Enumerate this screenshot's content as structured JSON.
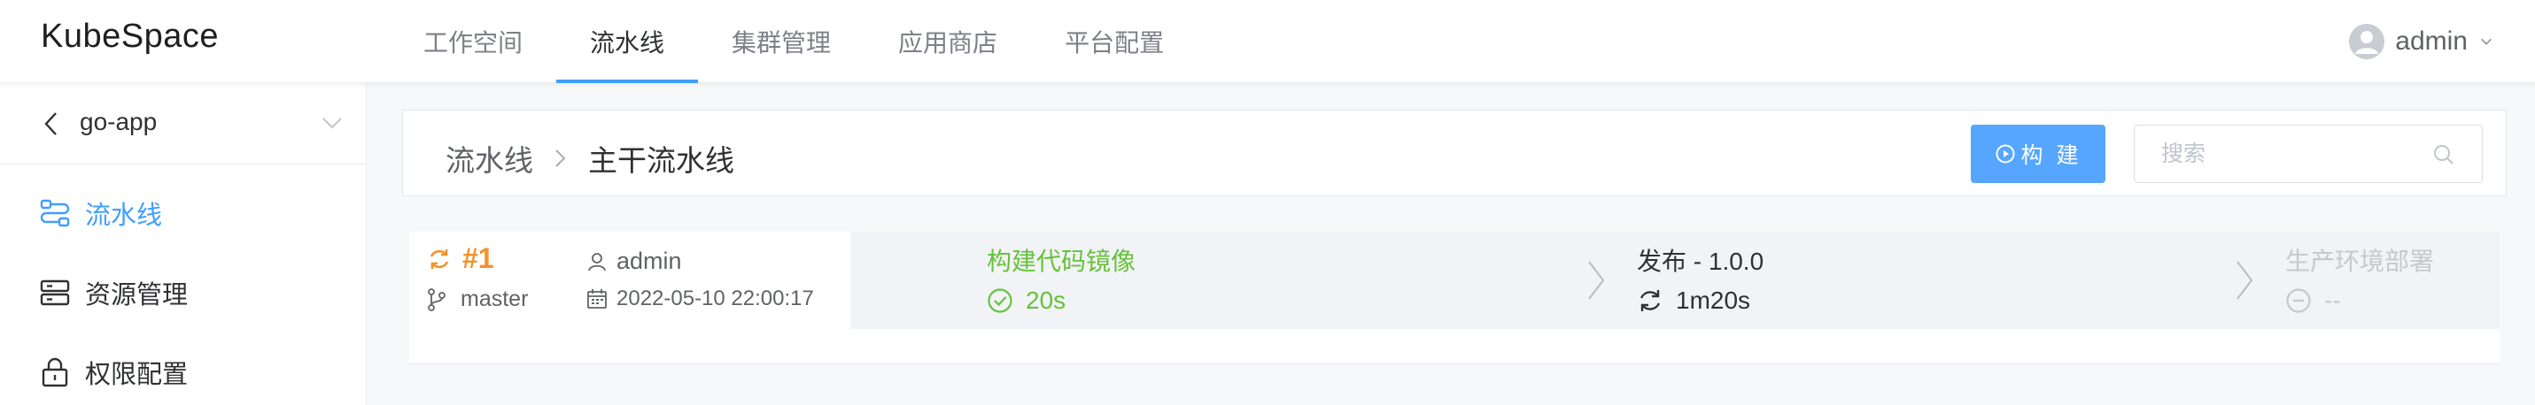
{
  "app": {
    "logo": "KubeSpace"
  },
  "nav": {
    "items": [
      {
        "label": "工作空间",
        "active": false
      },
      {
        "label": "流水线",
        "active": true
      },
      {
        "label": "集群管理",
        "active": false
      },
      {
        "label": "应用商店",
        "active": false
      },
      {
        "label": "平台配置",
        "active": false
      }
    ]
  },
  "user": {
    "name": "admin"
  },
  "sidebar": {
    "project": "go-app",
    "items": [
      {
        "label": "流水线",
        "icon": "pipeline-icon",
        "active": true
      },
      {
        "label": "资源管理",
        "icon": "storage-icon",
        "active": false
      },
      {
        "label": "权限配置",
        "icon": "lock-icon",
        "active": false
      }
    ]
  },
  "breadcrumb": {
    "root": "流水线",
    "current": "主干流水线"
  },
  "toolbar": {
    "build_label": "构 建",
    "search_placeholder": "搜索"
  },
  "run": {
    "number": "#1",
    "branch": "master",
    "author": "admin",
    "time": "2022-05-10 22:00:17",
    "stages": [
      {
        "title": "构建代码镜像",
        "status": "success",
        "duration": "20s"
      },
      {
        "title": "发布 - 1.0.0",
        "status": "running",
        "duration": "1m20s"
      },
      {
        "title": "生产环境部署",
        "status": "pending",
        "duration": "--"
      }
    ]
  },
  "colors": {
    "accent": "#409eff",
    "button": "#56a6ff",
    "success": "#67c23a",
    "running_id": "#f0932b",
    "pending": "#c6c8cc"
  }
}
